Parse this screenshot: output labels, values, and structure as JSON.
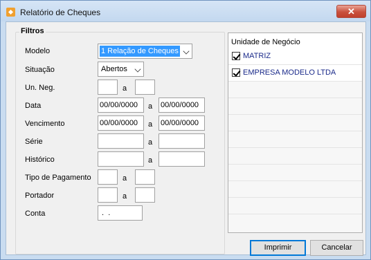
{
  "window": {
    "title": "Relatório de Cheques",
    "close_label": "✕"
  },
  "filtros": {
    "legend": "Filtros",
    "modelo": {
      "label": "Modelo",
      "value": "1 Relação de Cheques"
    },
    "situacao": {
      "label": "Situação",
      "value": "Abertos"
    },
    "un_neg": {
      "label": "Un. Neg.",
      "from": "",
      "sep": "a",
      "to": ""
    },
    "data": {
      "label": "Data",
      "from": "00/00/0000",
      "sep": "a",
      "to": "00/00/0000"
    },
    "vencimento": {
      "label": "Vencimento",
      "from": "00/00/0000",
      "sep": "a",
      "to": "00/00/0000"
    },
    "serie": {
      "label": "Série",
      "from": "",
      "sep": "a",
      "to": ""
    },
    "historico": {
      "label": "Histórico",
      "from": "",
      "sep": "a",
      "to": ""
    },
    "tipo_pagamento": {
      "label": "Tipo de Pagamento",
      "from": "",
      "sep": "a",
      "to": ""
    },
    "portador": {
      "label": "Portador",
      "from": "",
      "sep": "a",
      "to": ""
    },
    "conta": {
      "label": "Conta",
      "value": " .  ."
    }
  },
  "unidade": {
    "header": "Unidade de Negócio",
    "items": [
      {
        "label": "MATRIZ",
        "checked": true
      },
      {
        "label": "EMPRESA MODELO LTDA",
        "checked": true
      }
    ]
  },
  "buttons": {
    "imprimir": "Imprimir",
    "cancelar": "Cancelar"
  }
}
